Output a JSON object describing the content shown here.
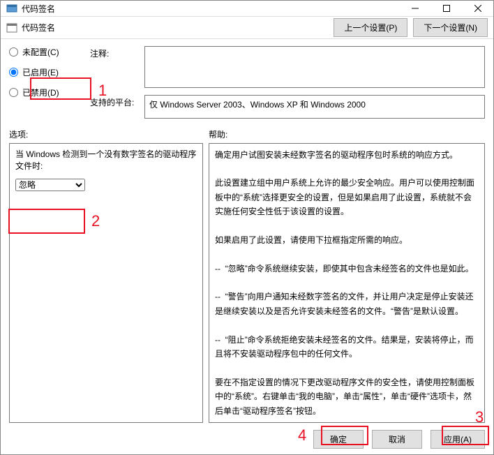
{
  "window": {
    "title": "代码签名"
  },
  "toolbar": {
    "title": "代码签名",
    "prev_label": "上一个设置(P)",
    "next_label": "下一个设置(N)"
  },
  "radios": {
    "unconfigured": "未配置(C)",
    "enabled": "已启用(E)",
    "disabled": "已禁用(D)"
  },
  "fields": {
    "comment_label": "注释:",
    "comment_value": "",
    "platform_label": "支持的平台:",
    "platform_value": "仅 Windows Server 2003、Windows XP 和 Windows 2000"
  },
  "section_labels": {
    "options": "选项:",
    "help": "帮助:"
  },
  "options": {
    "description": "当 Windows 检测到一个没有数字签名的驱动程序文件时:",
    "dropdown_value": "忽略"
  },
  "help_text": "确定用户试图安装未经数字签名的驱动程序包时系统的响应方式。\n\n此设置建立组中用户系统上允许的最少安全响应。用户可以使用控制面板中的“系统”选择更安全的设置，但是如果启用了此设置，系统就不会实施任何安全性低于该设置的设置。\n\n如果启用了此设置，请使用下拉框指定所需的响应。\n\n--  “忽略”命令系统继续安装，即使其中包含未经签名的文件也是如此。\n\n--  “警告”向用户通知未经数字签名的文件，并让用户决定是停止安装还是继续安装以及是否允许安装未经签名的文件。“警告”是默认设置。\n\n--  “阻止”命令系统拒绝安装未经签名的文件。结果是，安装将停止，而且将不安装驱动程序包中的任何文件。\n\n要在不指定设置的情况下更改驱动程序文件的安全性，请使用控制面板中的“系统”。右键单击“我的电脑”，单击“属性”，单击“硬件”选项卡，然后单击“驱动程序签名”按钮。",
  "buttons": {
    "ok": "确定",
    "cancel": "取消",
    "apply": "应用(A)"
  },
  "annotations": {
    "a1": "1",
    "a2": "2",
    "a3": "3",
    "a4": "4"
  }
}
